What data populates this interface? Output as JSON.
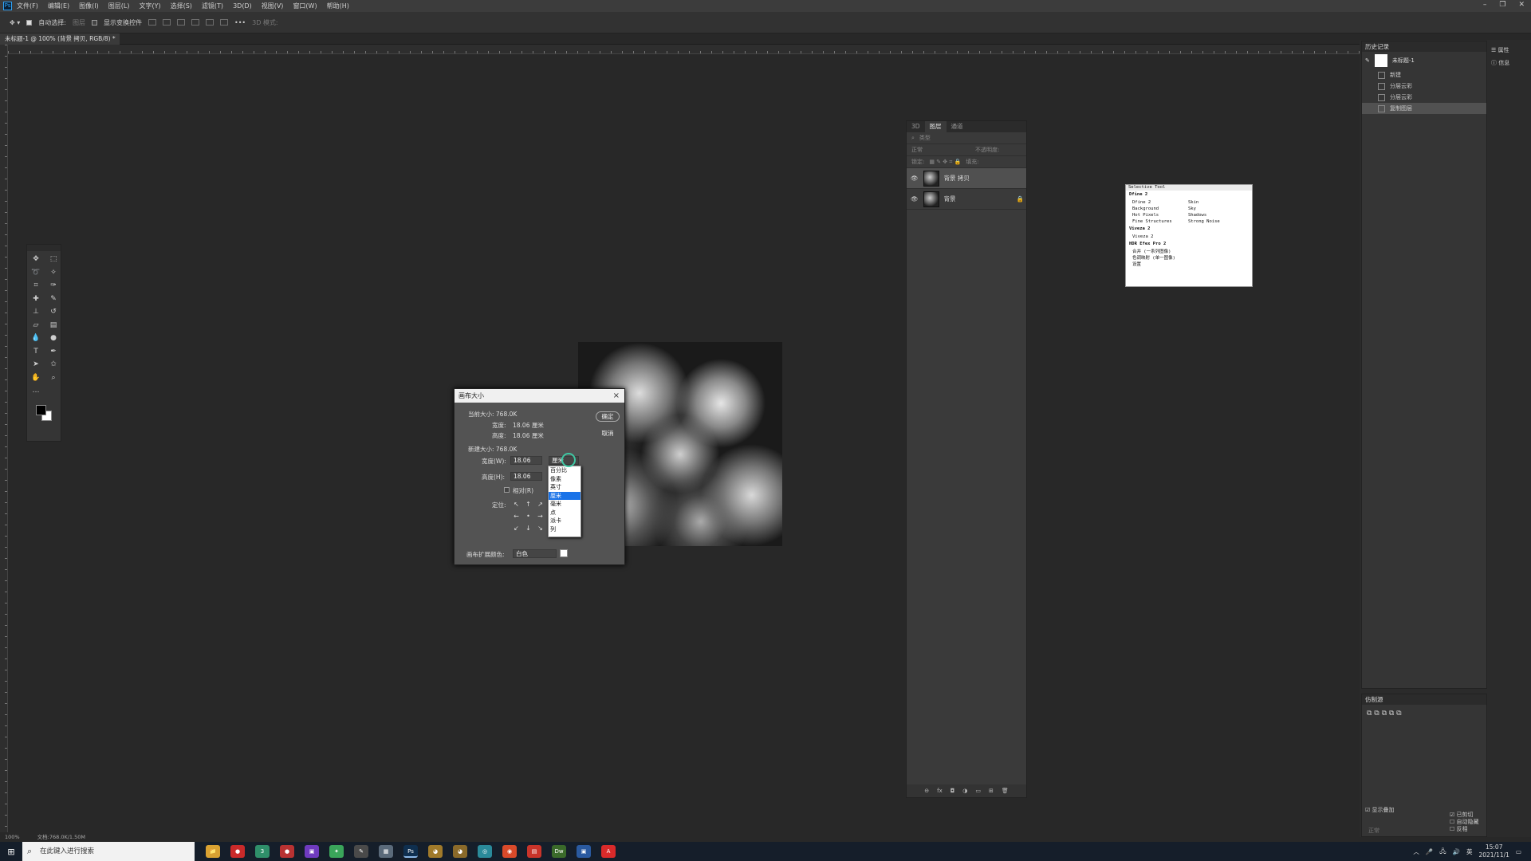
{
  "app": {
    "logo": "Ps"
  },
  "menubar": [
    "文件(F)",
    "编辑(E)",
    "图像(I)",
    "图层(L)",
    "文字(Y)",
    "选择(S)",
    "滤镜(T)",
    "3D(D)",
    "视图(V)",
    "窗口(W)",
    "帮助(H)"
  ],
  "options": {
    "auto_select": "自动选择:",
    "layer_select": "图层",
    "show_transform": "显示变换控件",
    "mode3d": "3D 模式:"
  },
  "doc_tab": "未标题-1 @ 100% (背景 拷贝, RGB/8) *",
  "dialog": {
    "title": "画布大小",
    "close": "×",
    "current_size": "当前大小: 768.0K",
    "width_label": "宽度:",
    "width_value": "18.06 厘米",
    "height_label": "高度:",
    "height_value": "18.06 厘米",
    "new_size": "新建大小: 768.0K",
    "new_width_label": "宽度(W):",
    "new_width": "18.06",
    "new_height_label": "高度(H):",
    "new_height": "18.06",
    "unit": "厘米",
    "relative": "相对(R)",
    "anchor_label": "定位:",
    "ext_color_label": "画布扩展颜色:",
    "ext_color": "白色",
    "ok": "确定",
    "cancel": "取消",
    "anchor": [
      "↖",
      "↑",
      "↗",
      "←",
      "•",
      "→",
      "↙",
      "↓",
      "↘"
    ]
  },
  "unit_options": [
    {
      "label": "百分比"
    },
    {
      "label": "像素"
    },
    {
      "label": "英寸"
    },
    {
      "label": "厘米",
      "selected": true
    },
    {
      "label": "毫米"
    },
    {
      "label": "点"
    },
    {
      "label": "派卡"
    },
    {
      "label": "列"
    }
  ],
  "layers_panel": {
    "tabs": [
      "3D",
      "图层",
      "通道"
    ],
    "search": "类型",
    "blend": "正常",
    "opacity": "不透明度:",
    "lock": "锁定:",
    "fill": "填充:",
    "layers": [
      {
        "name": "背景 拷贝",
        "active": true
      },
      {
        "name": "背景",
        "active": false
      }
    ],
    "footer": [
      "⊖",
      "fx",
      "◘",
      "◑",
      "▭",
      "⊞",
      "🗑"
    ]
  },
  "selective_tool": {
    "title": "Selective Tool",
    "sections": [
      {
        "name": "Dfine 2",
        "rows": [
          [
            "Dfine 2",
            "Skin"
          ],
          [
            "Background",
            "Sky"
          ],
          [
            "Hot Pixels",
            "Shadows"
          ],
          [
            "Fine Structures",
            "Strong Noise"
          ]
        ]
      },
      {
        "name": "Viveza 2",
        "rows": [
          [
            "Viveza 2",
            ""
          ]
        ]
      },
      {
        "name": "HDR Efex Pro 2",
        "rows": [
          [
            "合并 (一系列图像)",
            ""
          ],
          [
            "色调映射 (单一图像)",
            ""
          ],
          [
            "设置",
            ""
          ]
        ]
      }
    ]
  },
  "history": {
    "title": "历史记录",
    "snapshot": "未标题-1",
    "states": [
      "新建",
      "分层云彩",
      "分层云彩",
      "复制图层"
    ]
  },
  "side_tabs": [
    "属性",
    "信息"
  ],
  "properties": {
    "title": "仿制源",
    "show_overlay": "显示叠加",
    "clipped": "已剪切",
    "auto_hide": "自动隐藏",
    "invert": "反相",
    "normal": "正常"
  },
  "status": {
    "zoom": "100%",
    "doc": "文档:768.0K/1.50M"
  },
  "taskbar": {
    "search": "在此键入进行搜索",
    "apps": [
      {
        "label": "📁",
        "color": "#d9a232"
      },
      {
        "label": "●",
        "color": "#c92a2a"
      },
      {
        "label": "3",
        "color": "#2f8f6a"
      },
      {
        "label": "●",
        "color": "#b83232"
      },
      {
        "label": "▣",
        "color": "#6f3bbf"
      },
      {
        "label": "✦",
        "color": "#3aa55a"
      },
      {
        "label": "✎",
        "color": "#4a4a4a"
      },
      {
        "label": "▦",
        "color": "#5a6a7a"
      },
      {
        "label": "Ps",
        "color": "#0f2f4f",
        "active": true
      },
      {
        "label": "◕",
        "color": "#a07a2a"
      },
      {
        "label": "◕",
        "color": "#8a6a2a"
      },
      {
        "label": "◎",
        "color": "#2a8a9a"
      },
      {
        "label": "◉",
        "color": "#d94a2a"
      },
      {
        "label": "▤",
        "color": "#c9342a"
      },
      {
        "label": "Dw",
        "color": "#3a6a2a"
      },
      {
        "label": "▣",
        "color": "#2a5aa0"
      },
      {
        "label": "A",
        "color": "#d92a2a"
      }
    ],
    "ime": "英",
    "time": "15:07",
    "date": "2021/11/1"
  },
  "colors": {
    "accent": "#1a73e8",
    "cursor": "#3fc7a3"
  }
}
